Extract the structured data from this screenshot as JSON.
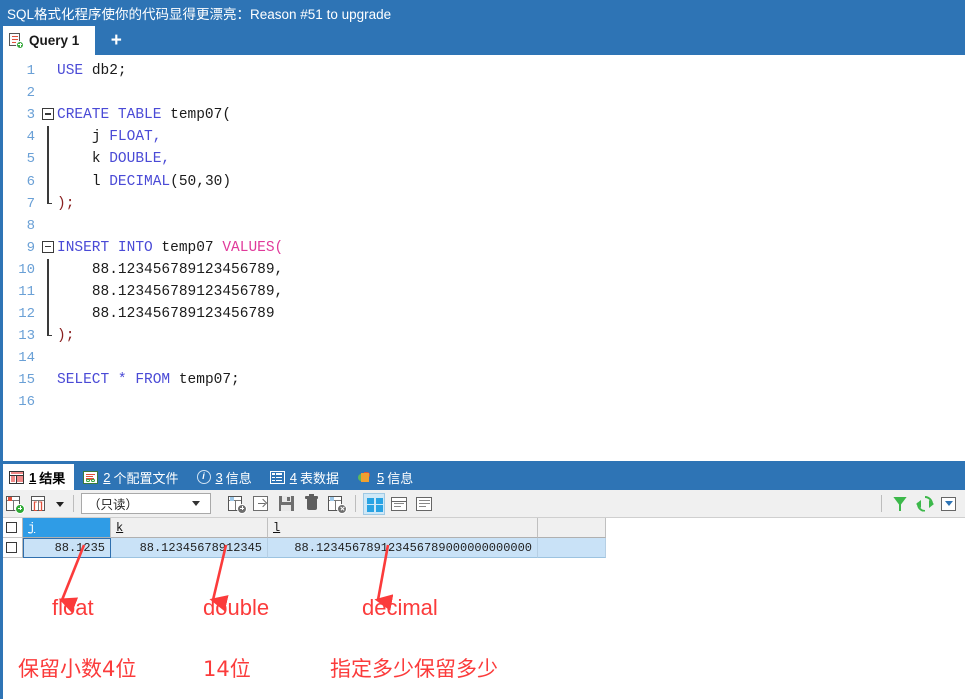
{
  "window": {
    "title": "SQL格式化程序使你的代码显得更漂亮：Reason #51 to upgrade"
  },
  "tabs": {
    "query_tab_label": "Query 1",
    "query_tab_icon": "query-sheet-icon",
    "new_tab_label": "+"
  },
  "editor": {
    "lines": [
      {
        "num": "1",
        "text": "  USE db2;"
      },
      {
        "num": "2",
        "text": ""
      },
      {
        "num": "3",
        "text": "CREATE TABLE temp07("
      },
      {
        "num": "4",
        "text": "      j FLOAT,"
      },
      {
        "num": "5",
        "text": "      k DOUBLE,"
      },
      {
        "num": "6",
        "text": "      l DECIMAL(50,30)"
      },
      {
        "num": "7",
        "text": ");"
      },
      {
        "num": "8",
        "text": ""
      },
      {
        "num": "9",
        "text": "INSERT INTO temp07 VALUES("
      },
      {
        "num": "10",
        "text": "      88.123456789123456789,"
      },
      {
        "num": "11",
        "text": "      88.123456789123456789,"
      },
      {
        "num": "12",
        "text": "      88.123456789123456789"
      },
      {
        "num": "13",
        "text": ");"
      },
      {
        "num": "14",
        "text": ""
      },
      {
        "num": "15",
        "text": "  SELECT * FROM temp07;"
      },
      {
        "num": "16",
        "text": ""
      }
    ],
    "tokens": {
      "use": "USE",
      "db": "db2;",
      "create": "CREATE TABLE",
      "table_name": "temp07(",
      "col_j": "j",
      "type_float": "FLOAT,",
      "col_k": "k",
      "type_double": "DOUBLE,",
      "col_l": "l",
      "type_decimal": "DECIMAL",
      "decimal_args": "(50,30)",
      "close_paren": ");",
      "insert": "INSERT INTO",
      "insert_table": "temp07",
      "values": "VALUES(",
      "value_1": "88.123456789123456789,",
      "value_2": "88.123456789123456789,",
      "value_3": "88.123456789123456789",
      "select": "SELECT",
      "star": "*",
      "from": "FROM",
      "select_table": "temp07;"
    }
  },
  "result_tabs": [
    {
      "num": "1",
      "label": "结果",
      "icon": "result-grid-icon",
      "active": true
    },
    {
      "num": "2",
      "label": "个配置文件",
      "icon": "profile-icon",
      "active": false
    },
    {
      "num": "3",
      "label": "信息",
      "icon": "info-circle-icon",
      "active": false
    },
    {
      "num": "4",
      "label": "表数据",
      "icon": "table-data-icon",
      "active": false
    },
    {
      "num": "5",
      "label": "信息",
      "icon": "status-pie-icon",
      "active": false
    }
  ],
  "result_toolbar": {
    "mode_select_value": "（只读）",
    "buttons": [
      {
        "name": "apply-changes-icon"
      },
      {
        "name": "revert-changes-icon"
      },
      {
        "name": "new-row-icon"
      },
      {
        "name": "export-recordset-icon"
      },
      {
        "name": "save-icon"
      },
      {
        "name": "delete-row-icon"
      },
      {
        "name": "discard-icon"
      },
      {
        "name": "grid-view-icon"
      },
      {
        "name": "form-view-icon"
      },
      {
        "name": "text-view-icon"
      },
      {
        "name": "filter-icon"
      },
      {
        "name": "refresh-icon"
      },
      {
        "name": "fetch-rows-icon"
      }
    ]
  },
  "result_grid": {
    "columns": [
      "j",
      "k",
      "l"
    ],
    "rows": [
      {
        "j": "88.1235",
        "k": "88.12345678912345",
        "l": "88.123456789123456789000000000000"
      }
    ]
  },
  "annotations": {
    "labels": [
      {
        "text": "float",
        "target": "j-column"
      },
      {
        "text": "double",
        "target": "k-column"
      },
      {
        "text": "decimal",
        "target": "l-column"
      }
    ],
    "notes": [
      {
        "text": "保留小数4位"
      },
      {
        "text": "14位"
      },
      {
        "text": "指定多少保留多少"
      }
    ]
  },
  "colors": {
    "chrome_blue": "#2e74b5",
    "keyword_blue": "#4a4ad6",
    "keyword_magenta": "#e0399a",
    "annotation_red": "#fb3b3b",
    "grid_row_blue": "#c9e2f7",
    "header_active_blue": "#2f9ce6",
    "accent_green": "#3cb84a"
  }
}
